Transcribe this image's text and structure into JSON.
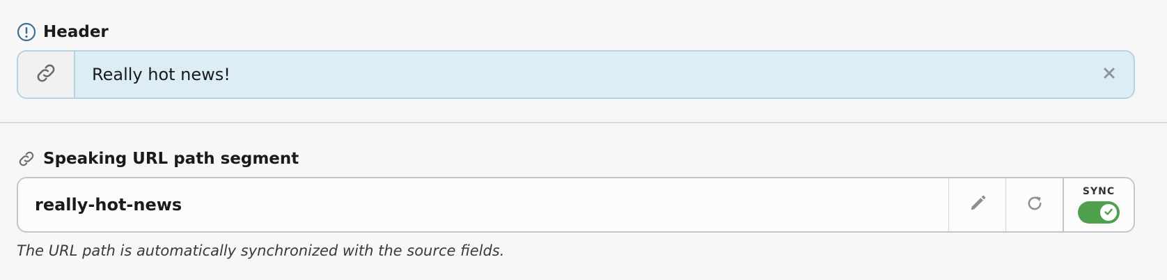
{
  "header_field": {
    "label": "Header",
    "value": "Really hot news!",
    "icons": {
      "label_icon": "info-circle-icon",
      "addon_icon": "link-icon",
      "clear_icon": "close-icon"
    }
  },
  "slug_field": {
    "label": "Speaking URL path segment",
    "value": "really-hot-news",
    "sync_label": "SYNC",
    "sync_enabled": true,
    "help_text": "The URL path is automatically synchronized with the source fields.",
    "icons": {
      "label_icon": "link-icon",
      "edit_icon": "pencil-icon",
      "refresh_icon": "refresh-icon",
      "toggle_icon": "check-icon"
    }
  },
  "colors": {
    "header_input_bg": "#dcedf5",
    "header_input_border": "#b7d3e2",
    "toggle_on": "#4ea04d",
    "label_icon_blue": "#3d6f8f"
  }
}
